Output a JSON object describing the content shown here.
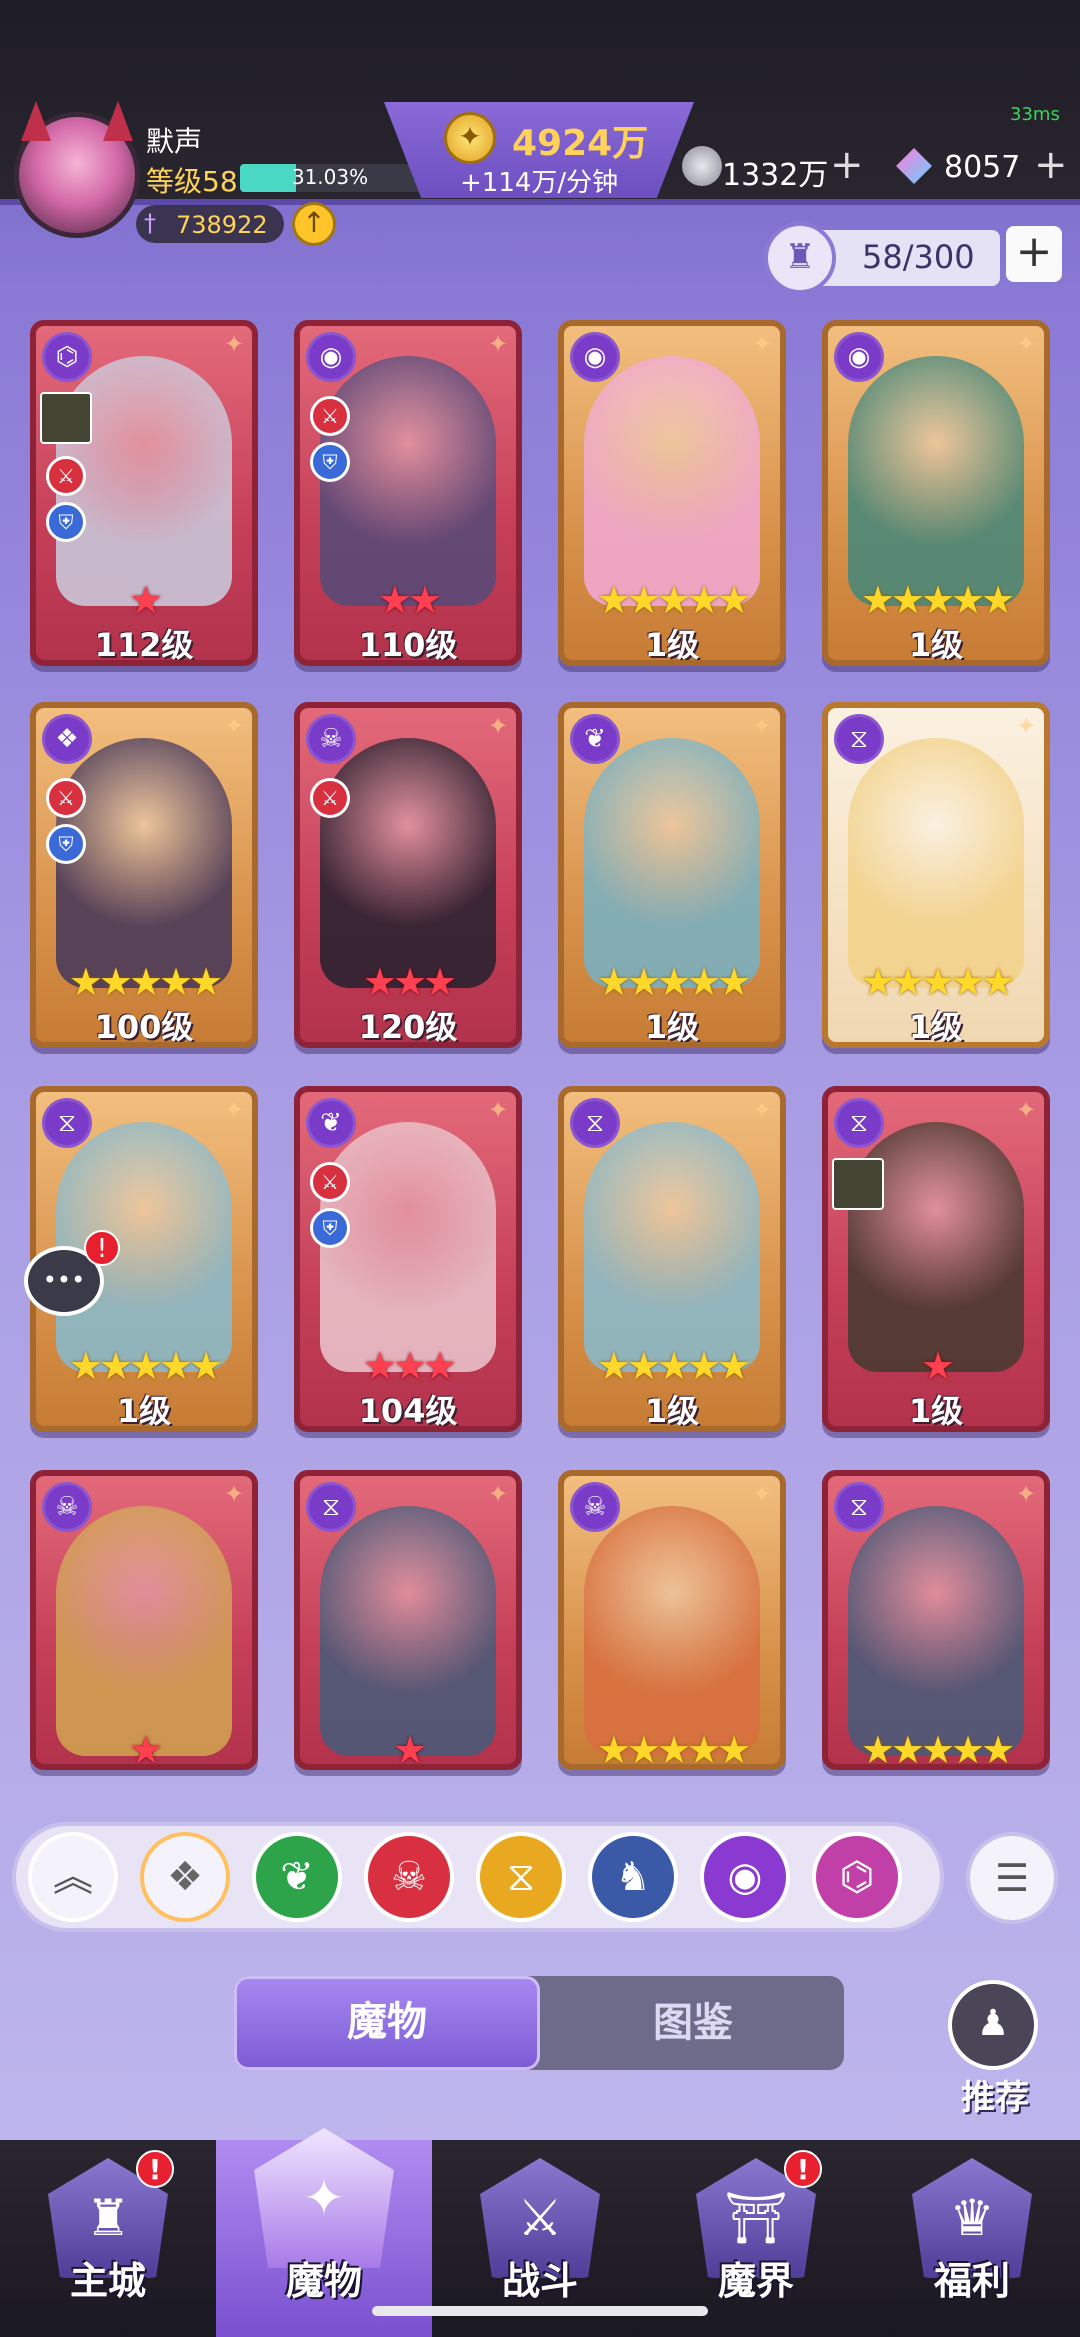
{
  "status": {
    "ping": "33ms"
  },
  "player": {
    "name": "默声",
    "level": "等级58",
    "exp_percent": "31.03%",
    "exp_fraction": 0.3103,
    "power": "738922"
  },
  "currency": {
    "gold": "4924万",
    "gold_rate": "+114万/分钟",
    "silver": "1332万",
    "gems": "8057",
    "plus": "+"
  },
  "capacity": {
    "value": "58/300",
    "plus": "+"
  },
  "cards": [
    {
      "style": "red",
      "faction": "⌬",
      "stars": "★",
      "star_color": "red",
      "level": "112级",
      "art": "#c9c6d8"
    },
    {
      "style": "red",
      "faction": "◉",
      "stars": "★★",
      "star_color": "red",
      "level": "110级",
      "art": "#5a4a78"
    },
    {
      "style": "gold",
      "faction": "◉",
      "stars": "★★★★★",
      "star_color": "gold",
      "level": "1级",
      "art": "#f0a8d0"
    },
    {
      "style": "gold",
      "faction": "◉",
      "stars": "★★★★★",
      "star_color": "gold",
      "level": "1级",
      "art": "#4a8878"
    },
    {
      "style": "gold",
      "faction": "❖",
      "stars": "★★★★★",
      "star_color": "gold",
      "level": "100级",
      "art": "#4a3a5a"
    },
    {
      "style": "red",
      "faction": "☠",
      "stars": "★★★",
      "star_color": "red",
      "level": "120级",
      "art": "#2a2230"
    },
    {
      "style": "gold",
      "faction": "❦",
      "stars": "★★★★★",
      "star_color": "gold",
      "level": "1级",
      "art": "#7ab0c0"
    },
    {
      "style": "white",
      "faction": "⧖",
      "stars": "★★★★★",
      "star_color": "gold",
      "level": "1级",
      "art": "#f2d28a"
    },
    {
      "style": "gold",
      "faction": "⧖",
      "stars": "★★★★★",
      "star_color": "gold",
      "level": "1级",
      "art": "#8ab8c8"
    },
    {
      "style": "red",
      "faction": "❦",
      "stars": "★★★",
      "star_color": "red",
      "level": "104级",
      "art": "#e8c0c8"
    },
    {
      "style": "gold",
      "faction": "⧖",
      "stars": "★★★★★",
      "star_color": "gold",
      "level": "1级",
      "art": "#8ab8c8"
    },
    {
      "style": "red",
      "faction": "⧖",
      "stars": "★",
      "star_color": "red",
      "level": "1级",
      "art": "#4a3a30"
    },
    {
      "style": "red",
      "faction": "☠",
      "stars": "★",
      "star_color": "red",
      "level": "",
      "art": "#d0a050"
    },
    {
      "style": "red",
      "faction": "⧖",
      "stars": "★",
      "star_color": "red",
      "level": "",
      "art": "#4a5a78"
    },
    {
      "style": "gold",
      "faction": "☠",
      "stars": "★★★★★",
      "star_color": "gold",
      "level": "",
      "art": "#d87040"
    },
    {
      "style": "red",
      "faction": "⧖",
      "stars": "★★★★★",
      "star_color": "gold",
      "level": "",
      "art": "#4a5a78"
    }
  ],
  "filters": [
    {
      "name": "collapse",
      "glyph": "︽",
      "color": "#f4f2fa",
      "fg": "#555"
    },
    {
      "name": "all",
      "glyph": "❖",
      "color": "#f4f2fa",
      "fg": "#666"
    },
    {
      "name": "nature",
      "glyph": "❦",
      "color": "#2ea44a",
      "fg": "#fff"
    },
    {
      "name": "demon",
      "glyph": "☠",
      "color": "#d83040",
      "fg": "#fff"
    },
    {
      "name": "time",
      "glyph": "⧖",
      "color": "#e8a820",
      "fg": "#fff"
    },
    {
      "name": "dragon",
      "glyph": "♞",
      "color": "#3a5aa8",
      "fg": "#fff"
    },
    {
      "name": "eye",
      "glyph": "◉",
      "color": "#8a3ad0",
      "fg": "#fff"
    },
    {
      "name": "chaos",
      "glyph": "⌬",
      "color": "#c040a8",
      "fg": "#fff"
    }
  ],
  "tabs": {
    "monster": "魔物",
    "handbook": "图鉴"
  },
  "recommend": {
    "label": "推荐"
  },
  "nav": [
    {
      "label": "主城",
      "glyph": "♜",
      "badge": "!"
    },
    {
      "label": "魔物",
      "glyph": "✦",
      "badge": ""
    },
    {
      "label": "战斗",
      "glyph": "⚔",
      "badge": ""
    },
    {
      "label": "魔界",
      "glyph": "⛩",
      "badge": "!"
    },
    {
      "label": "福利",
      "glyph": "♛",
      "badge": ""
    }
  ]
}
